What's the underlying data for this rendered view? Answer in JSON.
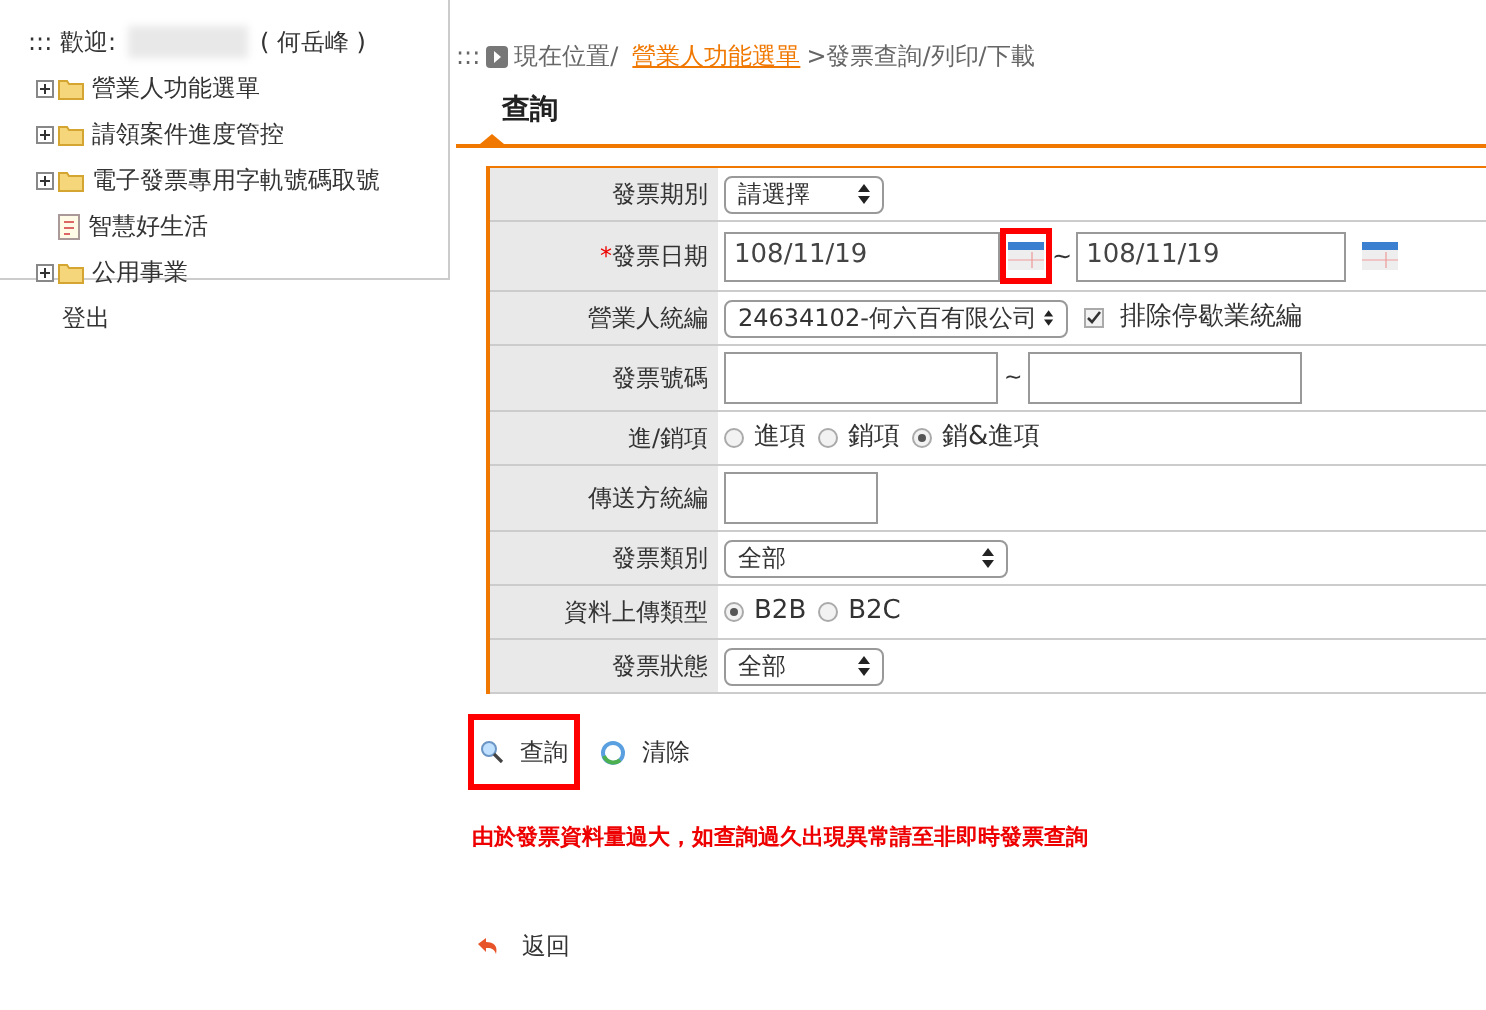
{
  "sidebar": {
    "welcome_prefix": "::: 歡迎:",
    "user_name": "( 何岳峰 )",
    "items": [
      {
        "kind": "folder",
        "label": "營業人功能選單",
        "expanded": false
      },
      {
        "kind": "folder",
        "label": "請領案件進度管控",
        "expanded": false
      },
      {
        "kind": "folder",
        "label": "電子發票專用字軌號碼取號",
        "expanded": false
      },
      {
        "kind": "page",
        "label": "智慧好生活"
      },
      {
        "kind": "folder",
        "label": "公用事業",
        "expanded": false
      },
      {
        "kind": "plain",
        "label": "登出"
      }
    ]
  },
  "breadcrumb": {
    "prefix": ":::",
    "location": "現在位置/",
    "link": "營業人功能選單",
    "current": ">發票查詢/列印/下載"
  },
  "section_title": "查詢",
  "form_rows": [
    {
      "kind": "select",
      "label": "發票期別",
      "value": "請選擇"
    },
    {
      "kind": "date_range",
      "label": "發票日期",
      "required_mark": "*",
      "from": "108/11/19",
      "to": "108/11/19",
      "separator": "~",
      "from_calendar_highlighted": true,
      "to_calendar_highlighted": false
    },
    {
      "kind": "select_check",
      "label": "營業人統編",
      "value": "24634102-何六百有限公司",
      "check_label": "排除停歇業統編",
      "checked": true
    },
    {
      "kind": "text_range",
      "label": "發票號碼",
      "separator": "~"
    },
    {
      "kind": "radio",
      "label": "進/銷項",
      "options": [
        {
          "label": "進項",
          "selected": false
        },
        {
          "label": "銷項",
          "selected": false
        },
        {
          "label": "銷&進項",
          "selected": true
        }
      ]
    },
    {
      "kind": "text",
      "label": "傳送方統編"
    },
    {
      "kind": "select",
      "label": "發票類別",
      "value": "全部"
    },
    {
      "kind": "radio",
      "label": "資料上傳類型",
      "options": [
        {
          "label": "B2B",
          "selected": true
        },
        {
          "label": "B2C",
          "selected": false
        }
      ]
    },
    {
      "kind": "select",
      "label": "發票狀態",
      "value": "全部"
    }
  ],
  "actions": [
    {
      "kind": "search",
      "label": "查詢",
      "highlighted": true
    },
    {
      "kind": "clear",
      "label": "清除",
      "highlighted": false
    }
  ],
  "warning": "由於發票資料量過大，如查詢過久出現異常請至非即時發票查詢",
  "back": "返回"
}
